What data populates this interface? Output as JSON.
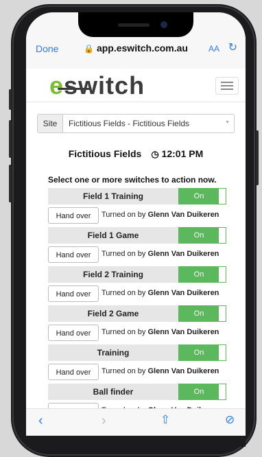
{
  "browser": {
    "done_label": "Done",
    "url": "app.eswitch.com.au",
    "text_size_label": "AA",
    "lock_icon": "lock-icon",
    "reload_icon": "reload-icon"
  },
  "brand": {
    "logo_first": "e",
    "logo_rest": "switch",
    "accent_color": "#7bbd33",
    "on_color": "#5cb85c"
  },
  "site_selector": {
    "label": "Site",
    "value": "Fictitious Fields - Fictitious Fields"
  },
  "header": {
    "title": "Fictitious Fields",
    "time": "12:01 PM"
  },
  "instructions": "Select one or more switches to action now.",
  "switches": [
    {
      "name": "Field 1 Training",
      "state": "On",
      "handover": "Hand over",
      "status_prefix": "Turned on by",
      "user": "Glenn Van Duikeren"
    },
    {
      "name": "Field 1 Game",
      "state": "On",
      "handover": "Hand over",
      "status_prefix": "Turned on by",
      "user": "Glenn Van Duikeren"
    },
    {
      "name": "Field 2 Training",
      "state": "On",
      "handover": "Hand over",
      "status_prefix": "Turned on by",
      "user": "Glenn Van Duikeren"
    },
    {
      "name": "Field 2 Game",
      "state": "On",
      "handover": "Hand over",
      "status_prefix": "Turned on by",
      "user": "Glenn Van Duikeren"
    },
    {
      "name": "Training",
      "state": "On",
      "handover": "Hand over",
      "status_prefix": "Turned on by",
      "user": "Glenn Van Duikeren"
    },
    {
      "name": "Ball finder",
      "state": "On",
      "handover": "Hand over",
      "status_prefix": "Turned on by",
      "user": "Glenn Van Duikeren"
    }
  ],
  "toolbar": {
    "back_icon": "back-icon",
    "forward_icon": "forward-icon",
    "share_icon": "share-icon",
    "compass_icon": "compass-icon"
  }
}
